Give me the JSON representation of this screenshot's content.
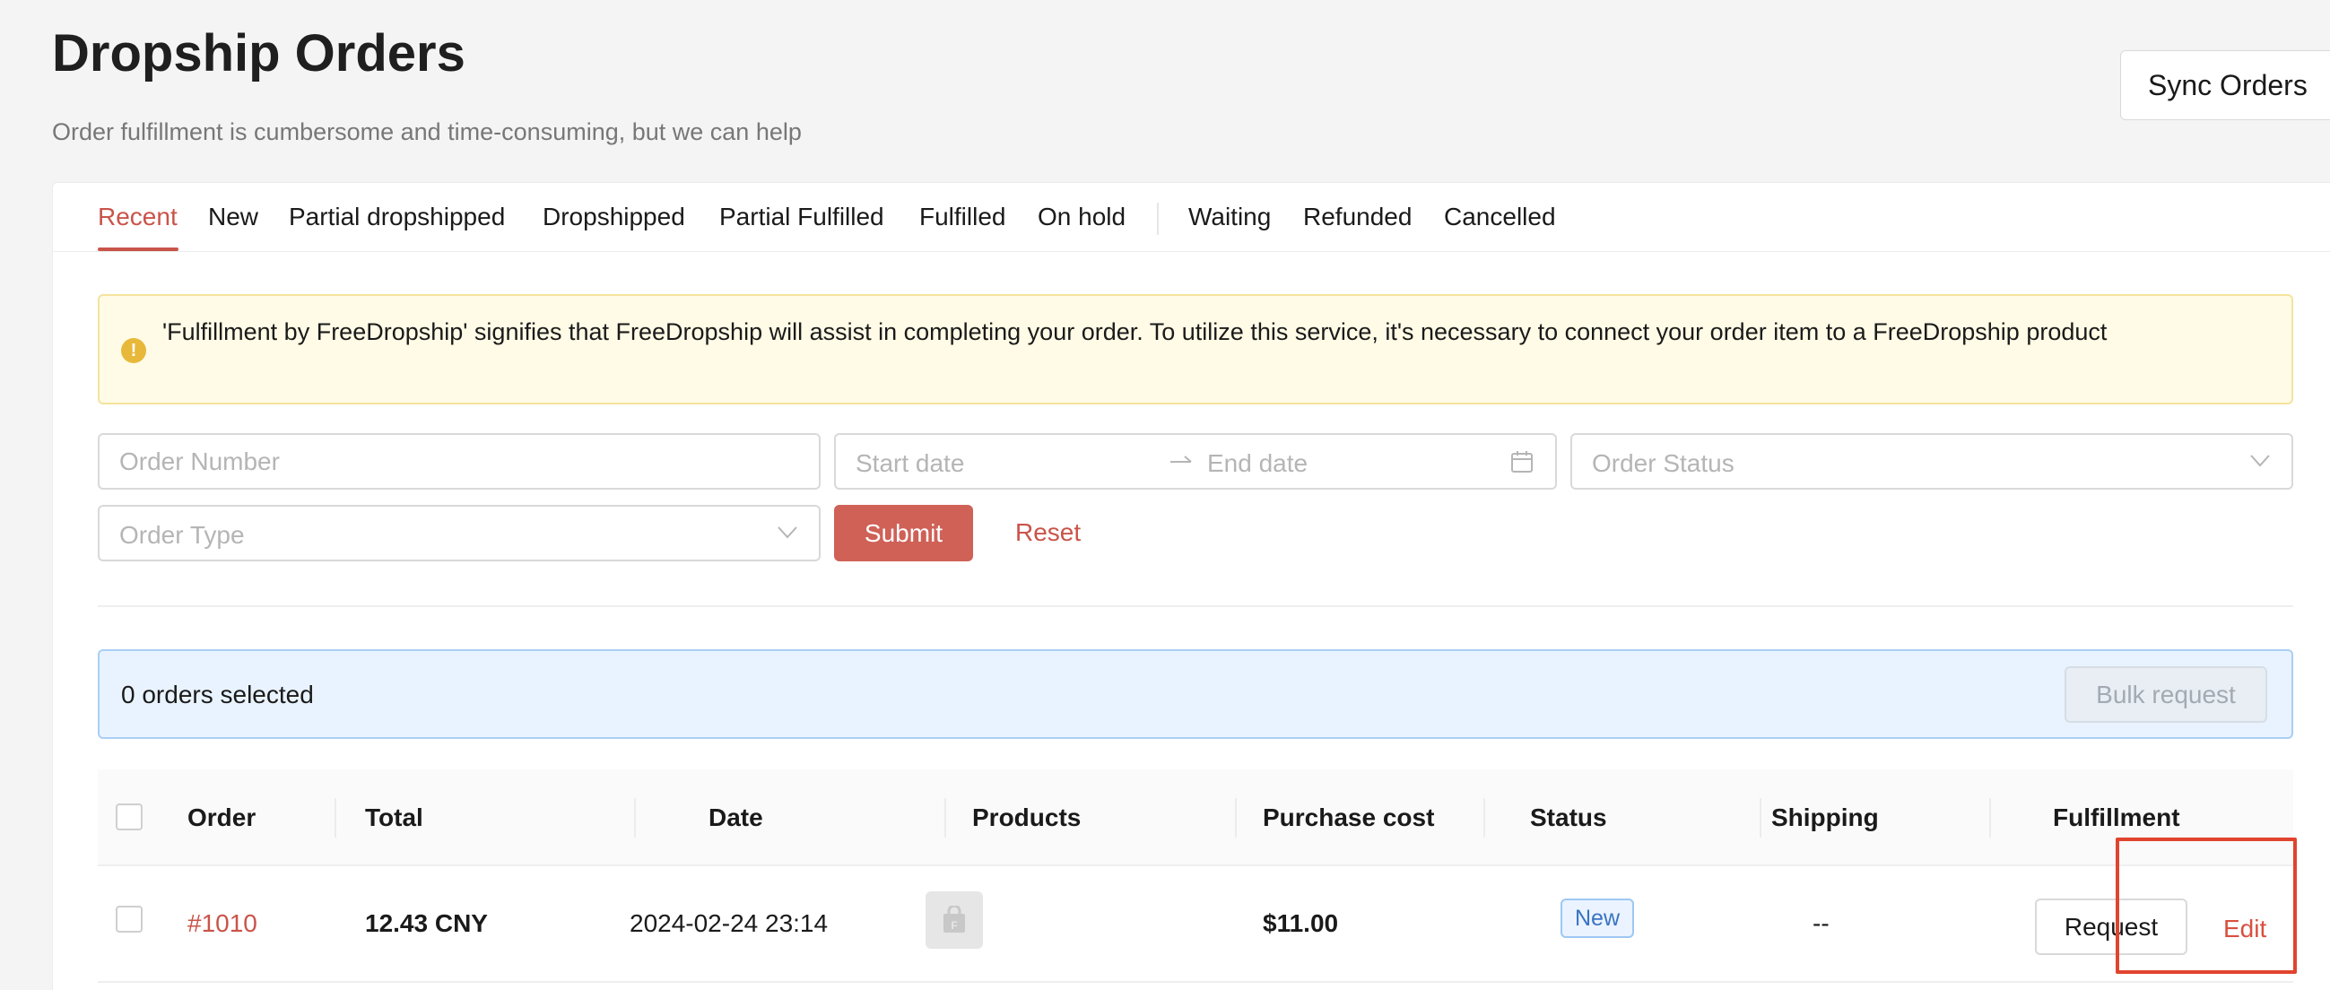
{
  "header": {
    "title": "Dropship Orders",
    "subtitle": "Order fulfillment is cumbersome and time-consuming, but we can help",
    "sync_button": "Sync Orders"
  },
  "tabs": [
    {
      "label": "Recent",
      "active": true
    },
    {
      "label": "New"
    },
    {
      "label": "Partial dropshipped"
    },
    {
      "label": "Dropshipped"
    },
    {
      "label": "Partial Fulfilled"
    },
    {
      "label": "Fulfilled"
    },
    {
      "label": "On hold"
    },
    {
      "label": "Waiting"
    },
    {
      "label": "Refunded"
    },
    {
      "label": "Cancelled"
    }
  ],
  "alert": {
    "icon": "exclamation-circle-icon",
    "text": "'Fulfillment by FreeDropship' signifies that FreeDropship will assist in completing your order. To utilize this service, it's necessary to connect your order item to a FreeDropship product"
  },
  "filters": {
    "order_number_placeholder": "Order Number",
    "start_date_placeholder": "Start date",
    "end_date_placeholder": "End date",
    "order_status_placeholder": "Order Status",
    "order_type_placeholder": "Order Type",
    "submit_label": "Submit",
    "reset_label": "Reset"
  },
  "selection": {
    "text": "0 orders selected",
    "bulk_label": "Bulk request"
  },
  "table": {
    "columns": [
      "Order",
      "Total",
      "Date",
      "Products",
      "Purchase cost",
      "Status",
      "Shipping",
      "Fulfillment"
    ],
    "rows": [
      {
        "order": "#1010",
        "total": "12.43 CNY",
        "date": "2024-02-24 23:14",
        "purchase_cost": "$11.00",
        "status": "New",
        "shipping": "--",
        "request_label": "Request",
        "edit_label": "Edit"
      }
    ]
  },
  "colors": {
    "accent": "#c9544a",
    "submit_bg": "#cf6157",
    "alert_bg": "#fffbe6",
    "selection_bg": "#e9f3ff",
    "highlight": "#e0442f"
  }
}
